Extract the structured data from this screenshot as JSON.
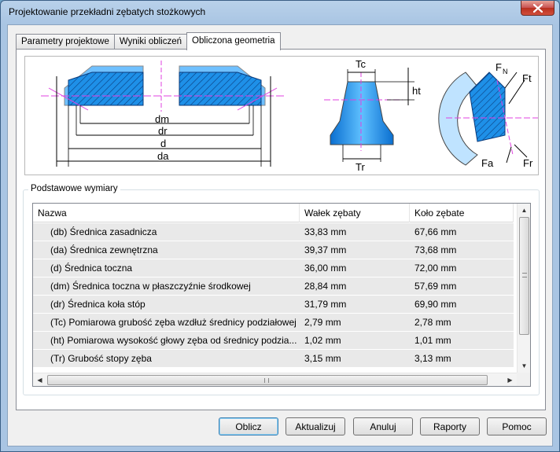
{
  "window": {
    "title": "Projektowanie przekładni zębatych stożkowych"
  },
  "tabs": [
    {
      "label": "Parametry projektowe"
    },
    {
      "label": "Wyniki obliczeń"
    },
    {
      "label": "Obliczona geometria"
    }
  ],
  "diagram": {
    "labels": {
      "dm": "dm",
      "dr": "dr",
      "d": "d",
      "da": "da",
      "tc": "Tc",
      "ht": "ht",
      "tr": "Tr",
      "fn": "F",
      "fn_sub": "N",
      "ft": "Ft",
      "fa": "Fa",
      "fr": "Fr"
    }
  },
  "group": {
    "label": "Podstawowe wymiary"
  },
  "table": {
    "columns": [
      "Nazwa",
      "Wałek zębaty",
      "Koło zębate"
    ],
    "rows": [
      [
        "(db) Średnica zasadnicza",
        "33,83 mm",
        "67,66 mm"
      ],
      [
        "(da) Średnica zewnętrzna",
        "39,37 mm",
        "73,68 mm"
      ],
      [
        "(d) Średnica toczna",
        "36,00 mm",
        "72,00 mm"
      ],
      [
        "(dm) Średnica toczna w płaszczyźnie środkowej",
        "28,84 mm",
        "57,69 mm"
      ],
      [
        "(dr) Średnica koła stóp",
        "31,79 mm",
        "69,90 mm"
      ],
      [
        "(Tc) Pomiarowa grubość zęba wzdłuż średnicy podziałowej",
        "2,79 mm",
        "2,78 mm"
      ],
      [
        "(ht) Pomiarowa wysokość głowy zęba od średnicy podzia...",
        "1,02 mm",
        "1,01 mm"
      ],
      [
        "(Tr) Grubość stopy zęba",
        "3,15 mm",
        "3,13 mm"
      ]
    ]
  },
  "buttons": {
    "oblicz": "Oblicz",
    "aktualizuj": "Aktualizuj",
    "anuluj": "Anuluj",
    "raporty": "Raporty",
    "pomoc": "Pomoc"
  }
}
